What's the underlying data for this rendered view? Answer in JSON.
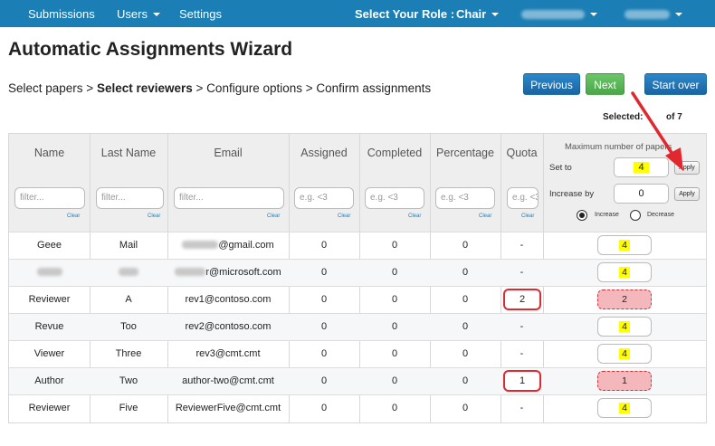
{
  "nav": {
    "submissions": "Submissions",
    "users": "Users",
    "settings": "Settings",
    "role_label": "Select Your Role :",
    "role_value": "Chair"
  },
  "page": {
    "title": "Automatic Assignments Wizard",
    "breadcrumb": {
      "step1": "Select papers >",
      "step2": "Select reviewers",
      "step3": "> Configure options > Confirm assignments"
    },
    "buttons": {
      "previous": "Previous",
      "next": "Next",
      "start_over": "Start over"
    },
    "selected_label": "Selected:",
    "selected_suffix": "of 7"
  },
  "table": {
    "headers": {
      "name": "Name",
      "last_name": "Last Name",
      "email": "Email",
      "assigned": "Assigned",
      "completed": "Completed",
      "percentage": "Percentage",
      "quota": "Quota"
    },
    "filters": {
      "name": "filter...",
      "last_name": "filter...",
      "email": "filter...",
      "assigned": "e.g. <3",
      "completed": "e.g. <3",
      "percentage": "e.g. <3",
      "quota": "e.g. <3",
      "clear": "Clear"
    },
    "max_panel": {
      "title": "Maximum number of papers",
      "set_to_label": "Set to",
      "set_to_value": "4",
      "increase_label": "Increase by",
      "increase_value": "0",
      "apply": "Apply",
      "radio_increase": "Increase",
      "radio_decrease": "Decrease"
    },
    "rows": [
      {
        "name": "Geee",
        "last": "Mail",
        "email": "@gmail.com",
        "assigned": "0",
        "completed": "0",
        "percentage": "0",
        "quota": "-",
        "max": "4"
      },
      {
        "name": "",
        "last": "",
        "email": "r@microsoft.com",
        "assigned": "0",
        "completed": "0",
        "percentage": "0",
        "quota": "-",
        "max": "4"
      },
      {
        "name": "Reviewer",
        "last": "A",
        "email": "rev1@contoso.com",
        "assigned": "0",
        "completed": "0",
        "percentage": "0",
        "quota": "2",
        "max": "2"
      },
      {
        "name": "Revue",
        "last": "Too",
        "email": "rev2@contoso.com",
        "assigned": "0",
        "completed": "0",
        "percentage": "0",
        "quota": "-",
        "max": "4"
      },
      {
        "name": "Viewer",
        "last": "Three",
        "email": "rev3@cmt.cmt",
        "assigned": "0",
        "completed": "0",
        "percentage": "0",
        "quota": "-",
        "max": "4"
      },
      {
        "name": "Author",
        "last": "Two",
        "email": "author-two@cmt.cmt",
        "assigned": "0",
        "completed": "0",
        "percentage": "0",
        "quota": "1",
        "max": "1"
      },
      {
        "name": "Reviewer",
        "last": "Five",
        "email": "ReviewerFive@cmt.cmt",
        "assigned": "0",
        "completed": "0",
        "percentage": "0",
        "quota": "-",
        "max": "4"
      }
    ]
  },
  "colors": {
    "navbar": "#1b7eb5",
    "next_button": "#5cb85c",
    "primary_button": "#1f6fb0",
    "highlight": "#ffff00",
    "quota_warning": "#f4b7bb",
    "annotation": "#e0282e"
  }
}
